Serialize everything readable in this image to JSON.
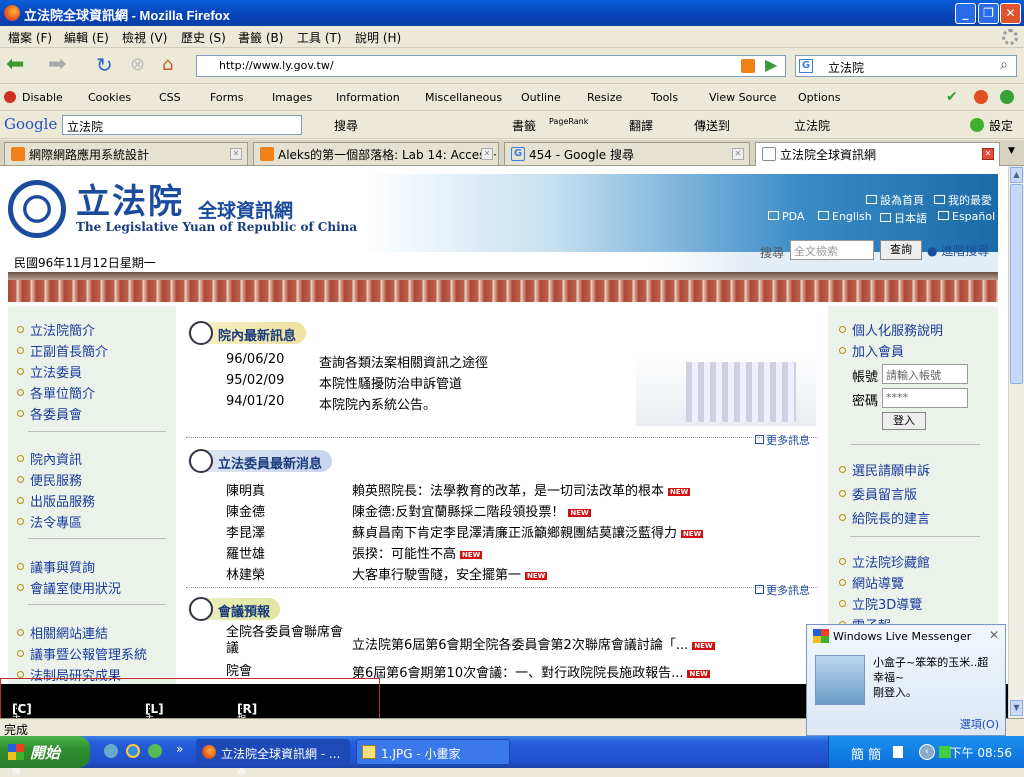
{
  "window": {
    "title": "立法院全球資訊網 - Mozilla Firefox"
  },
  "menubar": [
    "檔案 (F)",
    "編輯 (E)",
    "檢視 (V)",
    "歷史 (S)",
    "書籤 (B)",
    "工具 (T)",
    "說明 (H)"
  ],
  "nav": {
    "url": "http://www.ly.gov.tw/",
    "search_value": "立法院"
  },
  "devbar": [
    "Disable",
    "Cookies",
    "CSS",
    "Forms",
    "Images",
    "Information",
    "Miscellaneous",
    "Outline",
    "Resize",
    "Tools",
    "View Source",
    "Options"
  ],
  "googlebar": {
    "logo": "Google",
    "query": "立法院",
    "search": "搜尋",
    "bookmarks": "書籤",
    "pagerank": "PageRank",
    "translate": "翻譯",
    "sendto": "傳送到",
    "highlight": "立法院",
    "settings": "設定"
  },
  "tabs": [
    {
      "label": "網際網路應用系統設計",
      "color": "#f08018"
    },
    {
      "label": "Aleks的第一個部落格: Lab 14: Acces···",
      "color": "#f08018"
    },
    {
      "label": "454 - Google 搜尋",
      "color": "#3b7de0"
    },
    {
      "label": "立法院全球資訊網",
      "color": "#ffffff"
    }
  ],
  "site": {
    "name": "立法院",
    "subtitle": "全球資訊網",
    "english": "The Legislative Yuan of Republic of China",
    "date": "民國96年11月12日星期一",
    "top_links": [
      "設為首頁",
      "我的最愛",
      "PDA",
      "English",
      "日本語",
      "Español"
    ],
    "search_label": "搜尋",
    "search_placeholder": "全文檢索",
    "search_button": "查詢",
    "advanced_search": "進階搜尋"
  },
  "left_nav": [
    [
      "立法院簡介",
      "正副首長簡介",
      "立法委員",
      "各單位簡介",
      "各委員會"
    ],
    [
      "院內資訊",
      "便民服務",
      "出版品服務",
      "法令專區"
    ],
    [
      "議事與質詢",
      "會議室使用狀況"
    ],
    [
      "相關網站連結",
      "議事暨公報管理系統",
      "法制局研究成果"
    ]
  ],
  "news": {
    "title": "院內最新訊息",
    "items": [
      {
        "date": "96/06/20",
        "text": "查詢各類法案相關資訊之途徑"
      },
      {
        "date": "95/02/09",
        "text": "本院性騷擾防治申訴管道"
      },
      {
        "date": "94/01/20",
        "text": "本院院內系統公告。"
      }
    ],
    "more": "更多訊息"
  },
  "legislators": {
    "title": "立法委員最新消息",
    "items": [
      {
        "name": "陳明真",
        "text": "賴英照院長：法學教育的改革，是一切司法改革的根本"
      },
      {
        "name": "陳金德",
        "text": "陳金德:反對宜蘭縣採二階段領投票！"
      },
      {
        "name": "李昆澤",
        "text": "蘇貞昌南下肯定李昆澤清廉正派籲鄉親團結莫讓泛藍得力"
      },
      {
        "name": "羅世雄",
        "text": "張揆：可能性不高"
      },
      {
        "name": "林建榮",
        "text": "大客車行駛雪隧，安全擺第一"
      }
    ],
    "more": "更多訊息",
    "new_tag": "NEW"
  },
  "meetings": {
    "title": "會議預報",
    "items": [
      {
        "name": "全院各委員會聯席會議",
        "text": "立法院第6屆第6會期全院各委員會第2次聯席會議討論「..."
      },
      {
        "name": "院會",
        "text": "第6屆第6會期第10次會議：一、對行政院院長施政報告..."
      }
    ]
  },
  "right_nav": {
    "top": [
      "個人化服務說明",
      "加入會員"
    ],
    "account_label": "帳號",
    "account_placeholder": "請輸入帳號",
    "password_label": "密碼",
    "password_value": "****",
    "login": "登入",
    "mid": [
      "選民請願申訴",
      "委員留言版",
      "給院長的建言"
    ],
    "bottom": [
      "立法院珍藏館",
      "網站導覽",
      "立院3D導覽",
      "電子報·"
    ]
  },
  "accessibility": [
    {
      "key": "[C]",
      "text": ":::主要內容區"
    },
    {
      "key": "[L]",
      "text": ":::主選單"
    },
    {
      "key": "[R]",
      "text": ":::相關內容區"
    }
  ],
  "status": "完成",
  "messenger": {
    "title": "Windows Live Messenger",
    "message": "小盒子~笨笨的玉米..超幸福~",
    "sub": "剛登入。",
    "options": "選項(O)"
  },
  "taskbar": {
    "start": "開始",
    "tasks": [
      "立法院全球資訊網 - ...",
      "1.JPG - 小畫家"
    ],
    "ime": "簡 簡",
    "clock": "下午 08:56"
  }
}
